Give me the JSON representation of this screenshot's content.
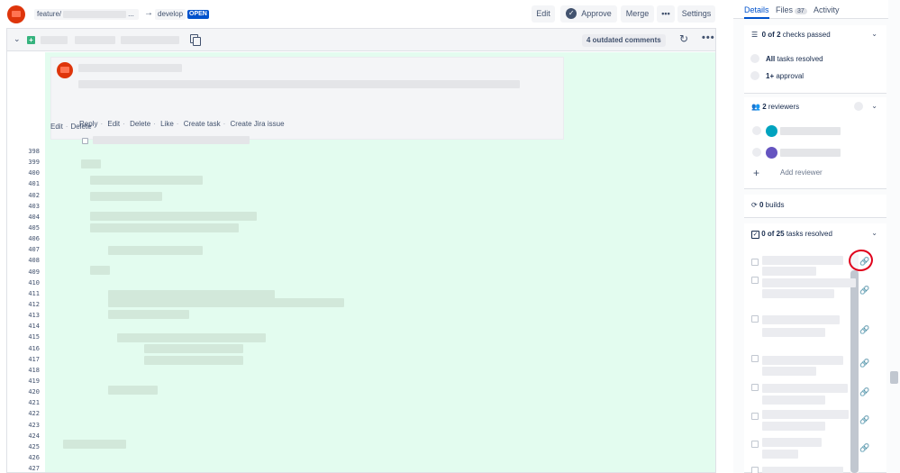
{
  "header": {
    "source_branch_prefix": "feature/",
    "source_branch_ellipsis": "...",
    "arrow": "→",
    "target_branch": "develop",
    "status": "OPEN",
    "buttons": {
      "edit": "Edit",
      "approve": "Approve",
      "merge": "Merge",
      "more": "•••",
      "settings": "Settings"
    }
  },
  "diff": {
    "chevron": "⌄",
    "add_icon": "+",
    "outdated_comments": "4 outdated comments",
    "refresh": "↻",
    "more": "•••",
    "comment": {
      "actions": [
        "Reply",
        "Edit",
        "Delete",
        "Like",
        "Create task",
        "Create Jira issue"
      ],
      "sub_actions": [
        "Edit",
        "Delete"
      ]
    },
    "line_numbers": [
      "398",
      "399",
      "400",
      "401",
      "402",
      "403",
      "404",
      "405",
      "406",
      "407",
      "408",
      "409",
      "410",
      "411",
      "412",
      "413",
      "414",
      "415",
      "416",
      "417",
      "418",
      "419",
      "420",
      "421",
      "422",
      "423",
      "424",
      "425",
      "426",
      "427"
    ]
  },
  "sidebar": {
    "tabs": {
      "details": "Details",
      "files": "Files",
      "files_count": "37",
      "activity": "Activity"
    },
    "checks": {
      "count": "0 of 2",
      "label": "checks passed",
      "items": [
        {
          "bold": "All",
          "rest": "tasks resolved"
        },
        {
          "bold": "1+",
          "rest": "approval"
        }
      ]
    },
    "reviewers": {
      "count": "2",
      "label": "reviewers",
      "add": "Add reviewer",
      "avatar_colors": [
        "#00a3bf",
        "#6554c0"
      ]
    },
    "builds": {
      "count": "0",
      "label": "builds"
    },
    "tasks": {
      "count": "0 of 25",
      "label": "tasks resolved"
    }
  }
}
